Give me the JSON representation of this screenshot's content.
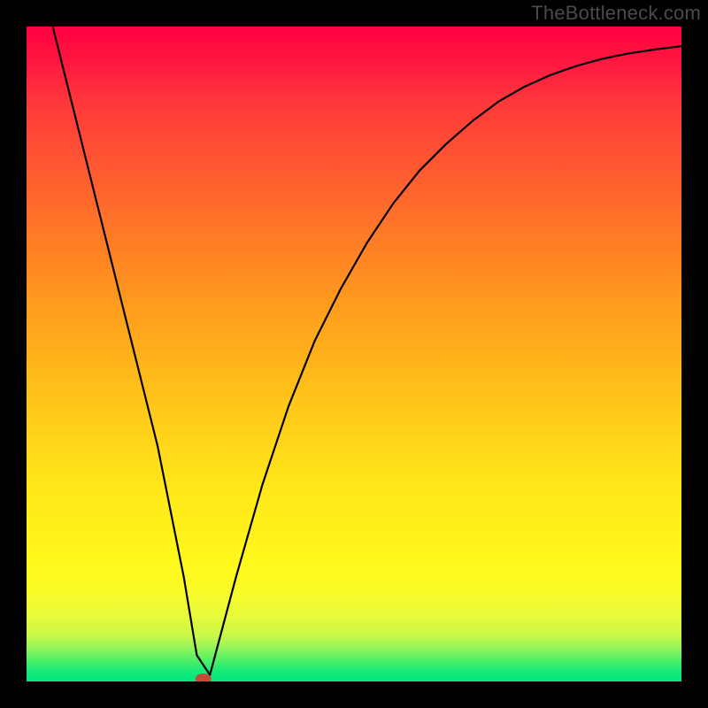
{
  "watermark": "TheBottleneck.com",
  "chart_data": {
    "type": "line",
    "title": "",
    "xlabel": "",
    "ylabel": "",
    "xlim": [
      0,
      100
    ],
    "ylim": [
      0,
      100
    ],
    "grid": false,
    "legend": false,
    "series": [
      {
        "name": "bottleneck-curve",
        "x": [
          4,
          8,
          12,
          16,
          20,
          24,
          26,
          28,
          32,
          36,
          40,
          44,
          48,
          52,
          56,
          60,
          64,
          68,
          72,
          76,
          80,
          84,
          88,
          92,
          96,
          100
        ],
        "values": [
          100,
          84,
          68,
          52,
          36,
          16,
          4,
          1,
          16,
          30,
          42,
          52,
          60,
          67,
          73,
          78,
          82,
          85.5,
          88.5,
          90.8,
          92.6,
          94,
          95.1,
          95.9,
          96.5,
          97
        ]
      }
    ],
    "annotations": [
      {
        "name": "minimum-marker",
        "x": 27,
        "y": 0.4,
        "color": "#c44a3a"
      }
    ],
    "background": {
      "type": "vertical-gradient",
      "stops": [
        {
          "pos": 0.0,
          "color": "#ff0040"
        },
        {
          "pos": 0.5,
          "color": "#ffb61a"
        },
        {
          "pos": 0.82,
          "color": "#fff81a"
        },
        {
          "pos": 1.0,
          "color": "#00e880"
        }
      ]
    }
  }
}
